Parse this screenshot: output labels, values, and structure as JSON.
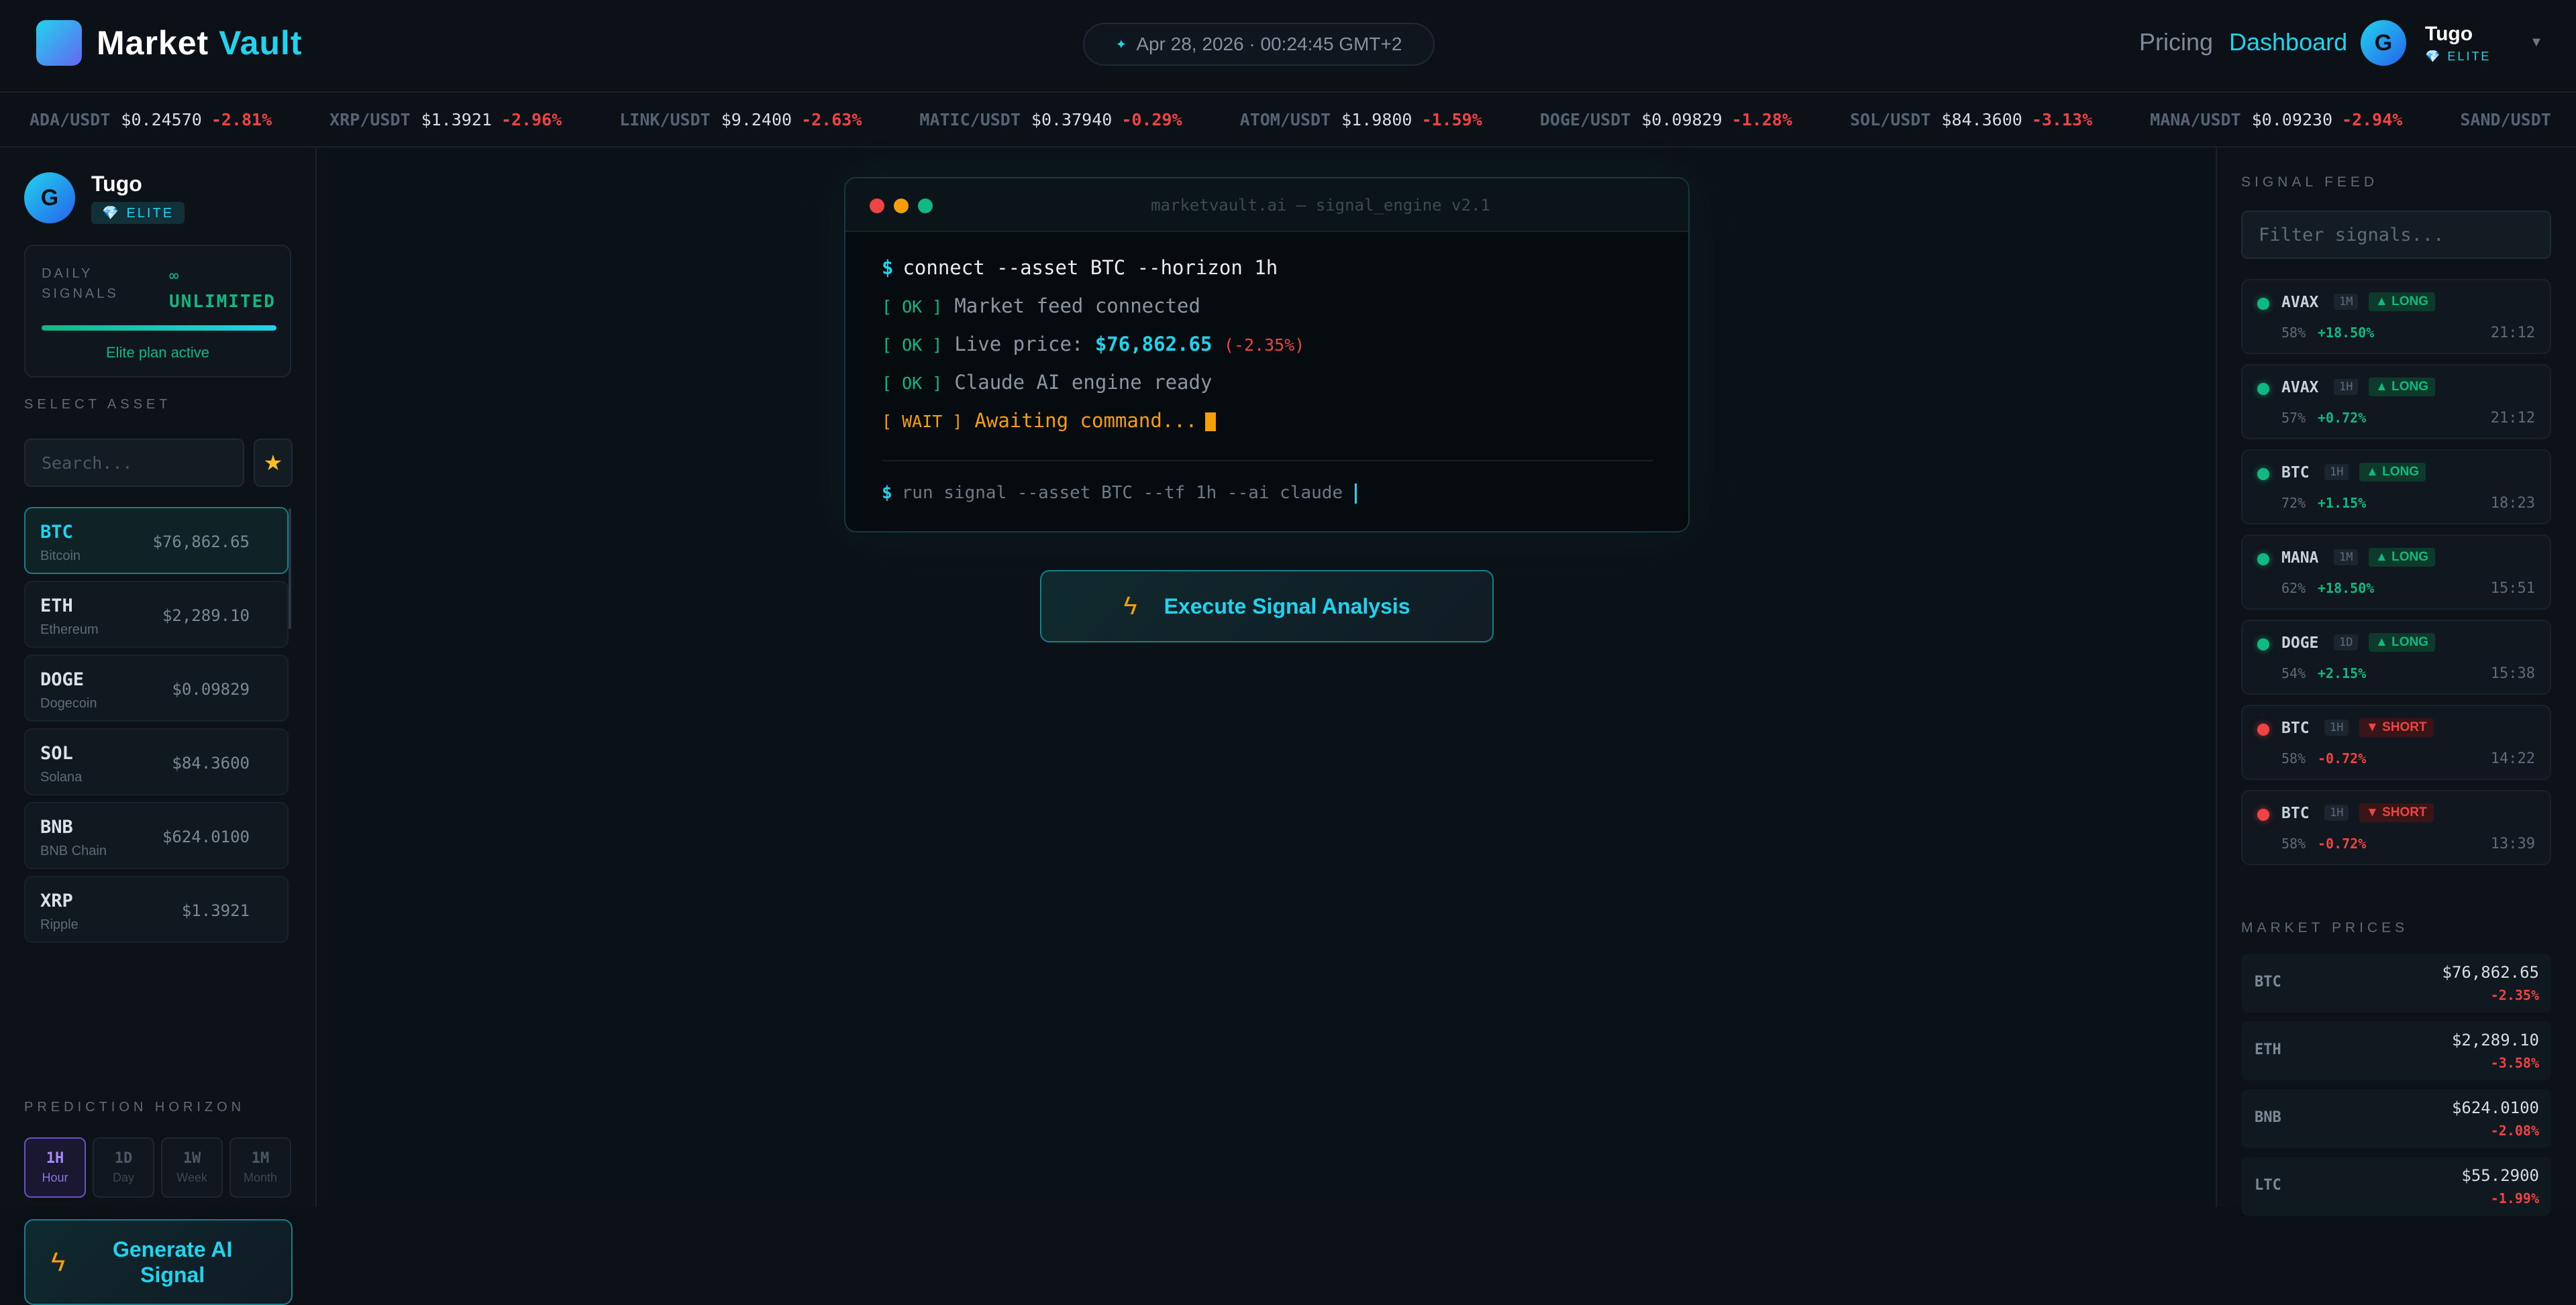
{
  "header": {
    "logo_word1": "Market",
    "logo_word2": "Vault",
    "datetime": "Apr 28, 2026 · 00:24:45 GMT+2",
    "nav_pricing": "Pricing",
    "nav_dashboard": "Dashboard",
    "user_name": "Tugo",
    "user_tier": "ELITE",
    "avatar_letter": "G"
  },
  "ticker": [
    {
      "sym": "ADA/USDT",
      "price": "$0.24570",
      "chg": "-2.81%"
    },
    {
      "sym": "XRP/USDT",
      "price": "$1.3921",
      "chg": "-2.96%"
    },
    {
      "sym": "LINK/USDT",
      "price": "$9.2400",
      "chg": "-2.63%"
    },
    {
      "sym": "MATIC/USDT",
      "price": "$0.37940",
      "chg": "-0.29%"
    },
    {
      "sym": "ATOM/USDT",
      "price": "$1.9800",
      "chg": "-1.59%"
    },
    {
      "sym": "DOGE/USDT",
      "price": "$0.09829",
      "chg": "-1.28%"
    },
    {
      "sym": "SOL/USDT",
      "price": "$84.3600",
      "chg": "-3.13%"
    },
    {
      "sym": "MANA/USDT",
      "price": "$0.09230",
      "chg": "-2.94%"
    },
    {
      "sym": "SAND/USDT",
      "price": "",
      "chg": ""
    }
  ],
  "left": {
    "user_name": "Tugo",
    "tier": "ELITE",
    "daily_label": "DAILY SIGNALS",
    "daily_symbol": "∞",
    "daily_value": "UNLIMITED",
    "daily_progress": 1.0,
    "plan_status": "Elite plan active",
    "select_asset_label": "SELECT ASSET",
    "search_placeholder": "Search...",
    "assets": [
      {
        "sym": "BTC",
        "name": "Bitcoin",
        "price": "$76,862.65",
        "selected": true
      },
      {
        "sym": "ETH",
        "name": "Ethereum",
        "price": "$2,289.10"
      },
      {
        "sym": "DOGE",
        "name": "Dogecoin",
        "price": "$0.09829"
      },
      {
        "sym": "SOL",
        "name": "Solana",
        "price": "$84.3600"
      },
      {
        "sym": "BNB",
        "name": "BNB Chain",
        "price": "$624.0100"
      },
      {
        "sym": "XRP",
        "name": "Ripple",
        "price": "$1.3921"
      }
    ],
    "horizon_label": "PREDICTION HORIZON",
    "horizons": [
      {
        "code": "1H",
        "name": "Hour",
        "active": true
      },
      {
        "code": "1D",
        "name": "Day"
      },
      {
        "code": "1W",
        "name": "Week"
      },
      {
        "code": "1M",
        "name": "Month"
      }
    ],
    "generate_label": "Generate AI Signal"
  },
  "terminal": {
    "title": "marketvault.ai — signal_engine v2.1",
    "prompt": "$",
    "command": "connect --asset BTC --horizon 1h",
    "ok_tag": "[ OK ]",
    "line_feed": "Market feed connected",
    "line_price_label": "Live price:",
    "live_price": "$76,862.65",
    "live_change": "(-2.35%)",
    "line_engine": "Claude AI engine ready",
    "wait_tag": "[ WAIT ]",
    "wait_text": "Awaiting command...",
    "input_command": "run signal --asset BTC --tf 1h --ai claude"
  },
  "execute_label": "Execute Signal Analysis",
  "right": {
    "feed_label": "SIGNAL FEED",
    "filter_placeholder": "Filter signals...",
    "signals": [
      {
        "asset": "AVAX",
        "tf": "1M",
        "dir": "▲ LONG",
        "type": "long",
        "conf": "58%",
        "pct": "+18.50%",
        "time": "21:12"
      },
      {
        "asset": "AVAX",
        "tf": "1H",
        "dir": "▲ LONG",
        "type": "long",
        "conf": "57%",
        "pct": "+0.72%",
        "time": "21:12"
      },
      {
        "asset": "BTC",
        "tf": "1H",
        "dir": "▲ LONG",
        "type": "long",
        "conf": "72%",
        "pct": "+1.15%",
        "time": "18:23"
      },
      {
        "asset": "MANA",
        "tf": "1M",
        "dir": "▲ LONG",
        "type": "long",
        "conf": "62%",
        "pct": "+18.50%",
        "time": "15:51"
      },
      {
        "asset": "DOGE",
        "tf": "1D",
        "dir": "▲ LONG",
        "type": "long",
        "conf": "54%",
        "pct": "+2.15%",
        "time": "15:38"
      },
      {
        "asset": "BTC",
        "tf": "1H",
        "dir": "▼ SHORT",
        "type": "short",
        "conf": "58%",
        "pct": "-0.72%",
        "time": "14:22"
      },
      {
        "asset": "BTC",
        "tf": "1H",
        "dir": "▼ SHORT",
        "type": "short",
        "conf": "58%",
        "pct": "-0.72%",
        "time": "13:39"
      }
    ],
    "prices_label": "MARKET PRICES",
    "prices": [
      {
        "sym": "BTC",
        "price": "$76,862.65",
        "chg": "-2.35%"
      },
      {
        "sym": "ETH",
        "price": "$2,289.10",
        "chg": "-3.58%"
      },
      {
        "sym": "BNB",
        "price": "$624.0100",
        "chg": "-2.08%"
      },
      {
        "sym": "LTC",
        "price": "$55.2900",
        "chg": "-1.99%"
      }
    ]
  },
  "colors": {
    "accent": "#22d3ee",
    "long": "#10b981",
    "short": "#ef4444",
    "warning": "#f59e0b",
    "horizon_active": "#a78bfa",
    "background": "#0a1016"
  }
}
